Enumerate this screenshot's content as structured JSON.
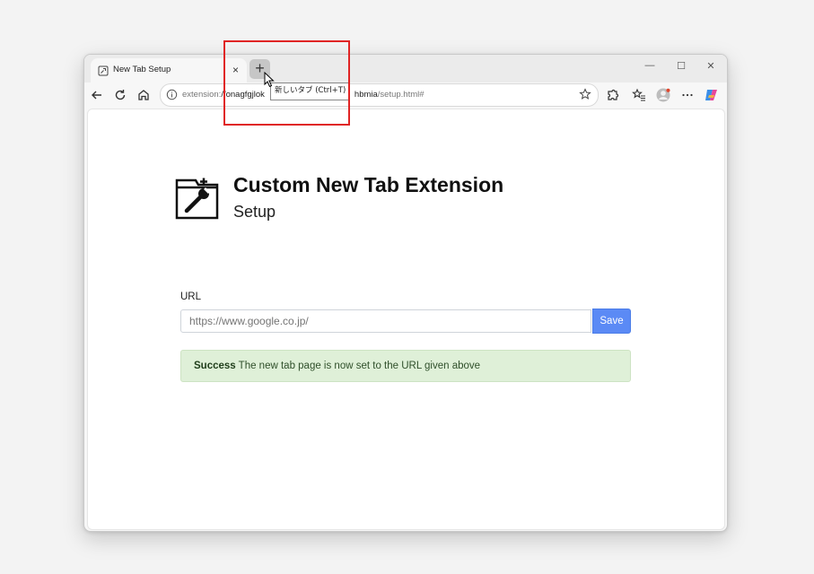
{
  "browser": {
    "tab": {
      "title": "New Tab Setup",
      "close": "×"
    },
    "new_tab_button": "+",
    "window_controls": {
      "minimize": "—",
      "maximize": "☐",
      "close": "✕"
    },
    "address_bar": {
      "prefix": "extension:",
      "host": "//onagfgjlok",
      "hidden_middle": "",
      "host_end": "hbmia",
      "path": "/setup.html#"
    },
    "tooltip": "新しいタブ (Ctrl+T)",
    "toolbar_icons": [
      "back-icon",
      "refresh-icon",
      "home-icon",
      "extensions-icon",
      "favorites-icon",
      "profile-icon",
      "more-icon",
      "copilot-icon"
    ]
  },
  "page": {
    "title": "Custom New Tab Extension",
    "subtitle": "Setup",
    "url_label": "URL",
    "url_placeholder": "https://www.google.co.jp/",
    "save_label": "Save",
    "alert": {
      "strong": "Success",
      "text": " The new tab page is now set to the URL given above"
    }
  },
  "colors": {
    "save_button": "#5b8af5",
    "alert_background": "#dff0d8",
    "highlight": "#e02424"
  }
}
